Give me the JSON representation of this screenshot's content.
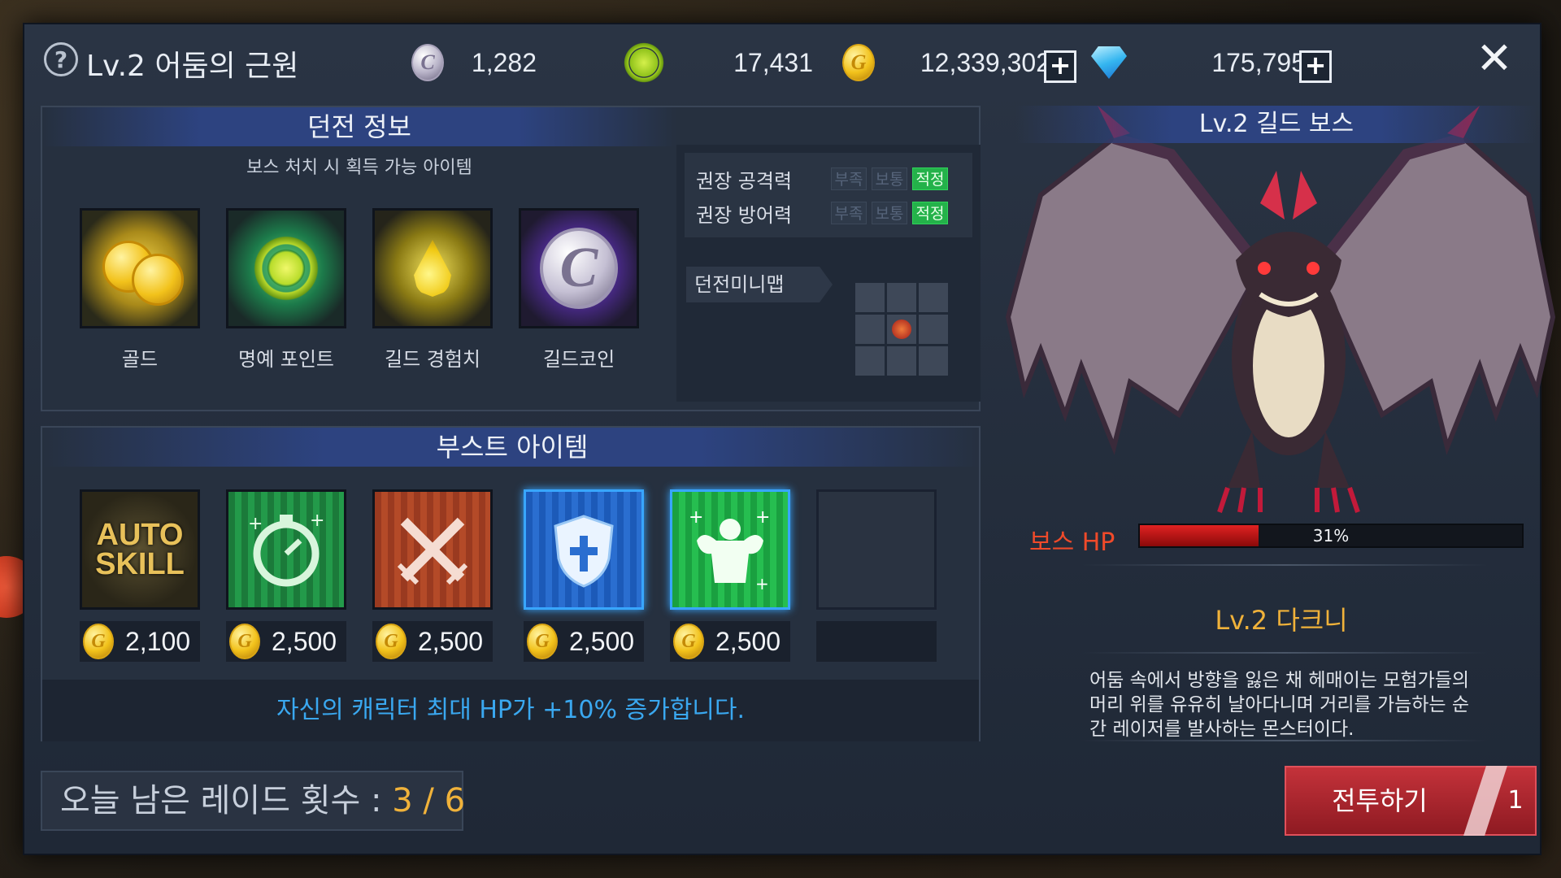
{
  "header": {
    "help_icon": "question-circle-icon",
    "title": "Lv.2 어둠의 근원",
    "guild_coin": "1,282",
    "honor_points": "17,431",
    "gold": "12,339,302",
    "gems": "175,795",
    "close_icon": "close-x-icon"
  },
  "dungeon_info": {
    "title": "던전 정보",
    "drops_subtitle": "보스 처치 시 획득 가능 아이템",
    "drops": [
      {
        "label": "골드",
        "icon": "gold-coins-icon"
      },
      {
        "label": "명예 포인트",
        "icon": "honor-laurel-icon"
      },
      {
        "label": "길드 경험치",
        "icon": "guild-exp-drop-icon"
      },
      {
        "label": "길드코인",
        "icon": "guild-coin-icon"
      }
    ],
    "stats": [
      {
        "label": "권장 공격력",
        "tags": [
          "부족",
          "보통",
          "적정"
        ],
        "active": "적정"
      },
      {
        "label": "권장 방어력",
        "tags": [
          "부족",
          "보통",
          "적정"
        ],
        "active": "적정"
      }
    ],
    "minimap_label": "던전미니맵"
  },
  "boost": {
    "title": "부스트 아이템",
    "items": [
      {
        "icon": "auto-skill-icon",
        "art_text_1": "AUTO",
        "art_text_2": "SKILL",
        "price": "2,100",
        "selected": false
      },
      {
        "icon": "stopwatch-icon",
        "price": "2,500",
        "selected": false
      },
      {
        "icon": "crossed-swords-icon",
        "price": "2,500",
        "selected": false
      },
      {
        "icon": "shield-cross-icon",
        "price": "2,500",
        "selected": true
      },
      {
        "icon": "muscle-body-icon",
        "price": "2,500",
        "selected": true
      }
    ],
    "description": "자신의 캐릭터 최대 HP가 +10%  증가합니다."
  },
  "raid": {
    "label": "오늘 남은 레이드 횟수 : ",
    "count": "3 / 6"
  },
  "boss": {
    "title": "Lv.2 길드 보스",
    "hp_label": "보스 HP",
    "hp_percent": 31,
    "hp_text": "31%",
    "name": "Lv.2 다크니",
    "description": "어둠 속에서 방향을 잃은 채 헤매이는 모험가들의 머리 위를 유유히 날아다니며 거리를 가늠하는 순간 레이저를 발사하는 몬스터이다."
  },
  "fight_button": {
    "label": "전투하기",
    "count": "1"
  },
  "colors": {
    "accent_orange": "#f0b23a",
    "hp_red": "#e02222",
    "desc_blue": "#3aa8f0",
    "good_green": "#24b24a"
  }
}
